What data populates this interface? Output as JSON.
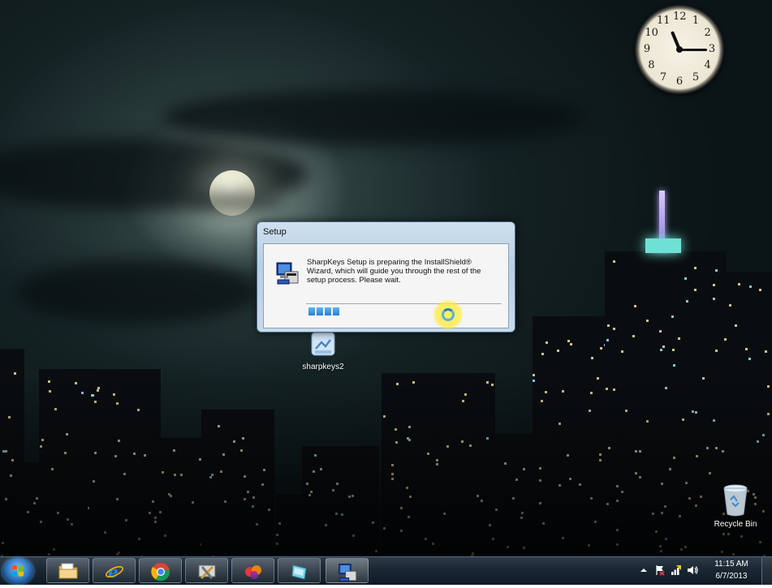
{
  "dialog": {
    "title": "Setup",
    "message": "SharpKeys Setup is preparing the InstallShield® Wizard, which will guide you through the rest of the setup process. Please wait.",
    "progress_segments": 4
  },
  "desktop_icons": {
    "sharpkeys": {
      "label": "sharpkeys2",
      "icon": "sharpkeys-installer-icon"
    },
    "recycle_bin": {
      "label": "Recycle Bin",
      "icon": "recycle-bin-icon"
    }
  },
  "gadget_clock": {
    "hours": "11",
    "minutes": "15",
    "numerals": [
      "12",
      "1",
      "2",
      "3",
      "4",
      "5",
      "6",
      "7",
      "8",
      "9",
      "10",
      "11"
    ]
  },
  "taskbar": {
    "start_icon": "windows-start-orb-icon",
    "pinned": [
      {
        "name": "windows-explorer",
        "icon": "folder-icon"
      },
      {
        "name": "internet-explorer",
        "icon": "internet-explorer-icon"
      },
      {
        "name": "google-chrome",
        "icon": "chrome-icon"
      },
      {
        "name": "tools",
        "icon": "tools-icon"
      },
      {
        "name": "media-app",
        "icon": "media-icon"
      },
      {
        "name": "app",
        "icon": "app-icon"
      },
      {
        "name": "setup",
        "icon": "setup-icon"
      }
    ],
    "tray": {
      "time": "11:15 AM",
      "date": "6/7/2013",
      "icons": [
        "show-hidden-icons-arrow",
        "action-center-flag-icon",
        "network-icon",
        "volume-icon"
      ]
    }
  },
  "colors": {
    "taskbar": "#1a2733",
    "dialog_frame": "#b7cfe4",
    "progress": "#2a7fd0",
    "cursor_highlight": "#ffeb3c"
  }
}
